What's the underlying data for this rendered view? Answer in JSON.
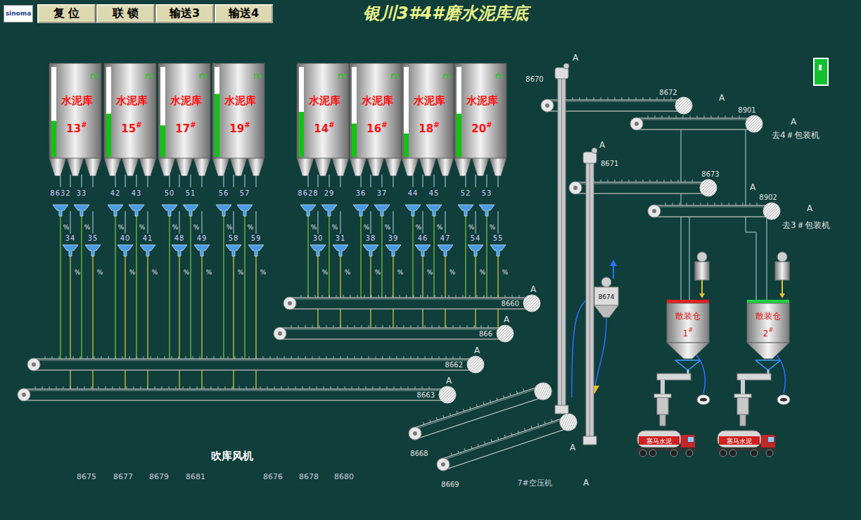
{
  "logo": "sinoma",
  "buttons": [
    "复 位",
    "联 锁",
    "输送3",
    "输送4"
  ],
  "title": "银川3#4#磨水泥库底",
  "indicator": {
    "on": true
  },
  "silos": [
    {
      "name": "水泥库",
      "number": "13",
      "suffix": "#",
      "unit": "m",
      "level": 0.4,
      "valves": [
        {
          "label": "8632",
          "pct": "%"
        },
        {
          "label": "33",
          "pct": "%"
        },
        {
          "label": "34",
          "pct": "%"
        },
        {
          "label": "35",
          "pct": "%"
        }
      ]
    },
    {
      "name": "水泥库",
      "number": "15",
      "suffix": "#",
      "unit": "m",
      "level": 0.48,
      "valves": [
        {
          "label": "42",
          "pct": "%"
        },
        {
          "label": "43",
          "pct": "%"
        },
        {
          "label": "40",
          "pct": "%"
        },
        {
          "label": "41",
          "pct": "%"
        }
      ]
    },
    {
      "name": "水泥库",
      "number": "17",
      "suffix": "#",
      "unit": "m",
      "level": 0.35,
      "valves": [
        {
          "label": "50",
          "pct": "%"
        },
        {
          "label": "51",
          "pct": "%"
        },
        {
          "label": "48",
          "pct": "%"
        },
        {
          "label": "49",
          "pct": "%"
        }
      ]
    },
    {
      "name": "水泥库",
      "number": "19",
      "suffix": "#",
      "unit": "m",
      "level": 0.7,
      "valves": [
        {
          "label": "56",
          "pct": "%"
        },
        {
          "label": "57",
          "pct": "%"
        },
        {
          "label": "58",
          "pct": "%"
        },
        {
          "label": "59",
          "pct": "%"
        }
      ]
    },
    {
      "name": "水泥库",
      "number": "14",
      "suffix": "#",
      "unit": "m",
      "level": 0.5,
      "valves": [
        {
          "label": "8628",
          "pct": "%"
        },
        {
          "label": "29",
          "pct": "%"
        },
        {
          "label": "30",
          "pct": "%"
        },
        {
          "label": "31",
          "pct": "%"
        }
      ]
    },
    {
      "name": "水泥库",
      "number": "16",
      "suffix": "#",
      "unit": "m",
      "level": 0.37,
      "valves": [
        {
          "label": "36",
          "pct": "%"
        },
        {
          "label": "37",
          "pct": "%"
        },
        {
          "label": "38",
          "pct": "%"
        },
        {
          "label": "39",
          "pct": "%"
        }
      ]
    },
    {
      "name": "水泥库",
      "number": "18",
      "suffix": "#",
      "unit": "m",
      "level": 0.26,
      "valves": [
        {
          "label": "44",
          "pct": "%"
        },
        {
          "label": "45",
          "pct": "%"
        },
        {
          "label": "46",
          "pct": "%"
        },
        {
          "label": "47",
          "pct": "%"
        }
      ]
    },
    {
      "name": "水泥库",
      "number": "20",
      "suffix": "#",
      "unit": "m",
      "level": 0.48,
      "valves": [
        {
          "label": "52",
          "pct": "%"
        },
        {
          "label": "53",
          "pct": "%"
        },
        {
          "label": "54",
          "pct": "%"
        },
        {
          "label": "55",
          "pct": "%"
        }
      ]
    }
  ],
  "belts": [
    {
      "id": "8660",
      "marker": "A"
    },
    {
      "id": "866",
      "marker": "A"
    },
    {
      "id": "8662",
      "marker": "A"
    },
    {
      "id": "8663",
      "marker": "A"
    },
    {
      "id": "8668"
    },
    {
      "id": "8669",
      "marker": "A"
    },
    {
      "id": "8672",
      "marker": "A"
    },
    {
      "id": "8901",
      "marker": "A",
      "destination": "去4＃包装机"
    },
    {
      "id": "8673",
      "marker": "A"
    },
    {
      "id": "8902",
      "marker": "A",
      "destination": "去3＃包装机"
    }
  ],
  "elevators": [
    {
      "id": "8670",
      "marker": "A"
    },
    {
      "id": "8671",
      "marker": "A"
    }
  ],
  "dustCollector": {
    "id": "8674"
  },
  "bulkSilos": [
    {
      "name": "散装仓",
      "number": "1",
      "suffix": "#",
      "color": "#e02020",
      "truck": "塞马水泥"
    },
    {
      "name": "散装仓",
      "number": "2",
      "suffix": "#",
      "color": "#20d040",
      "truck": "塞马水泥"
    }
  ],
  "fans": {
    "title": "吹库风机",
    "ids": [
      "8675",
      "8677",
      "8679",
      "8681",
      "8676",
      "8678",
      "8680"
    ]
  },
  "compressor": {
    "label": "7#空压机",
    "marker": "A"
  }
}
